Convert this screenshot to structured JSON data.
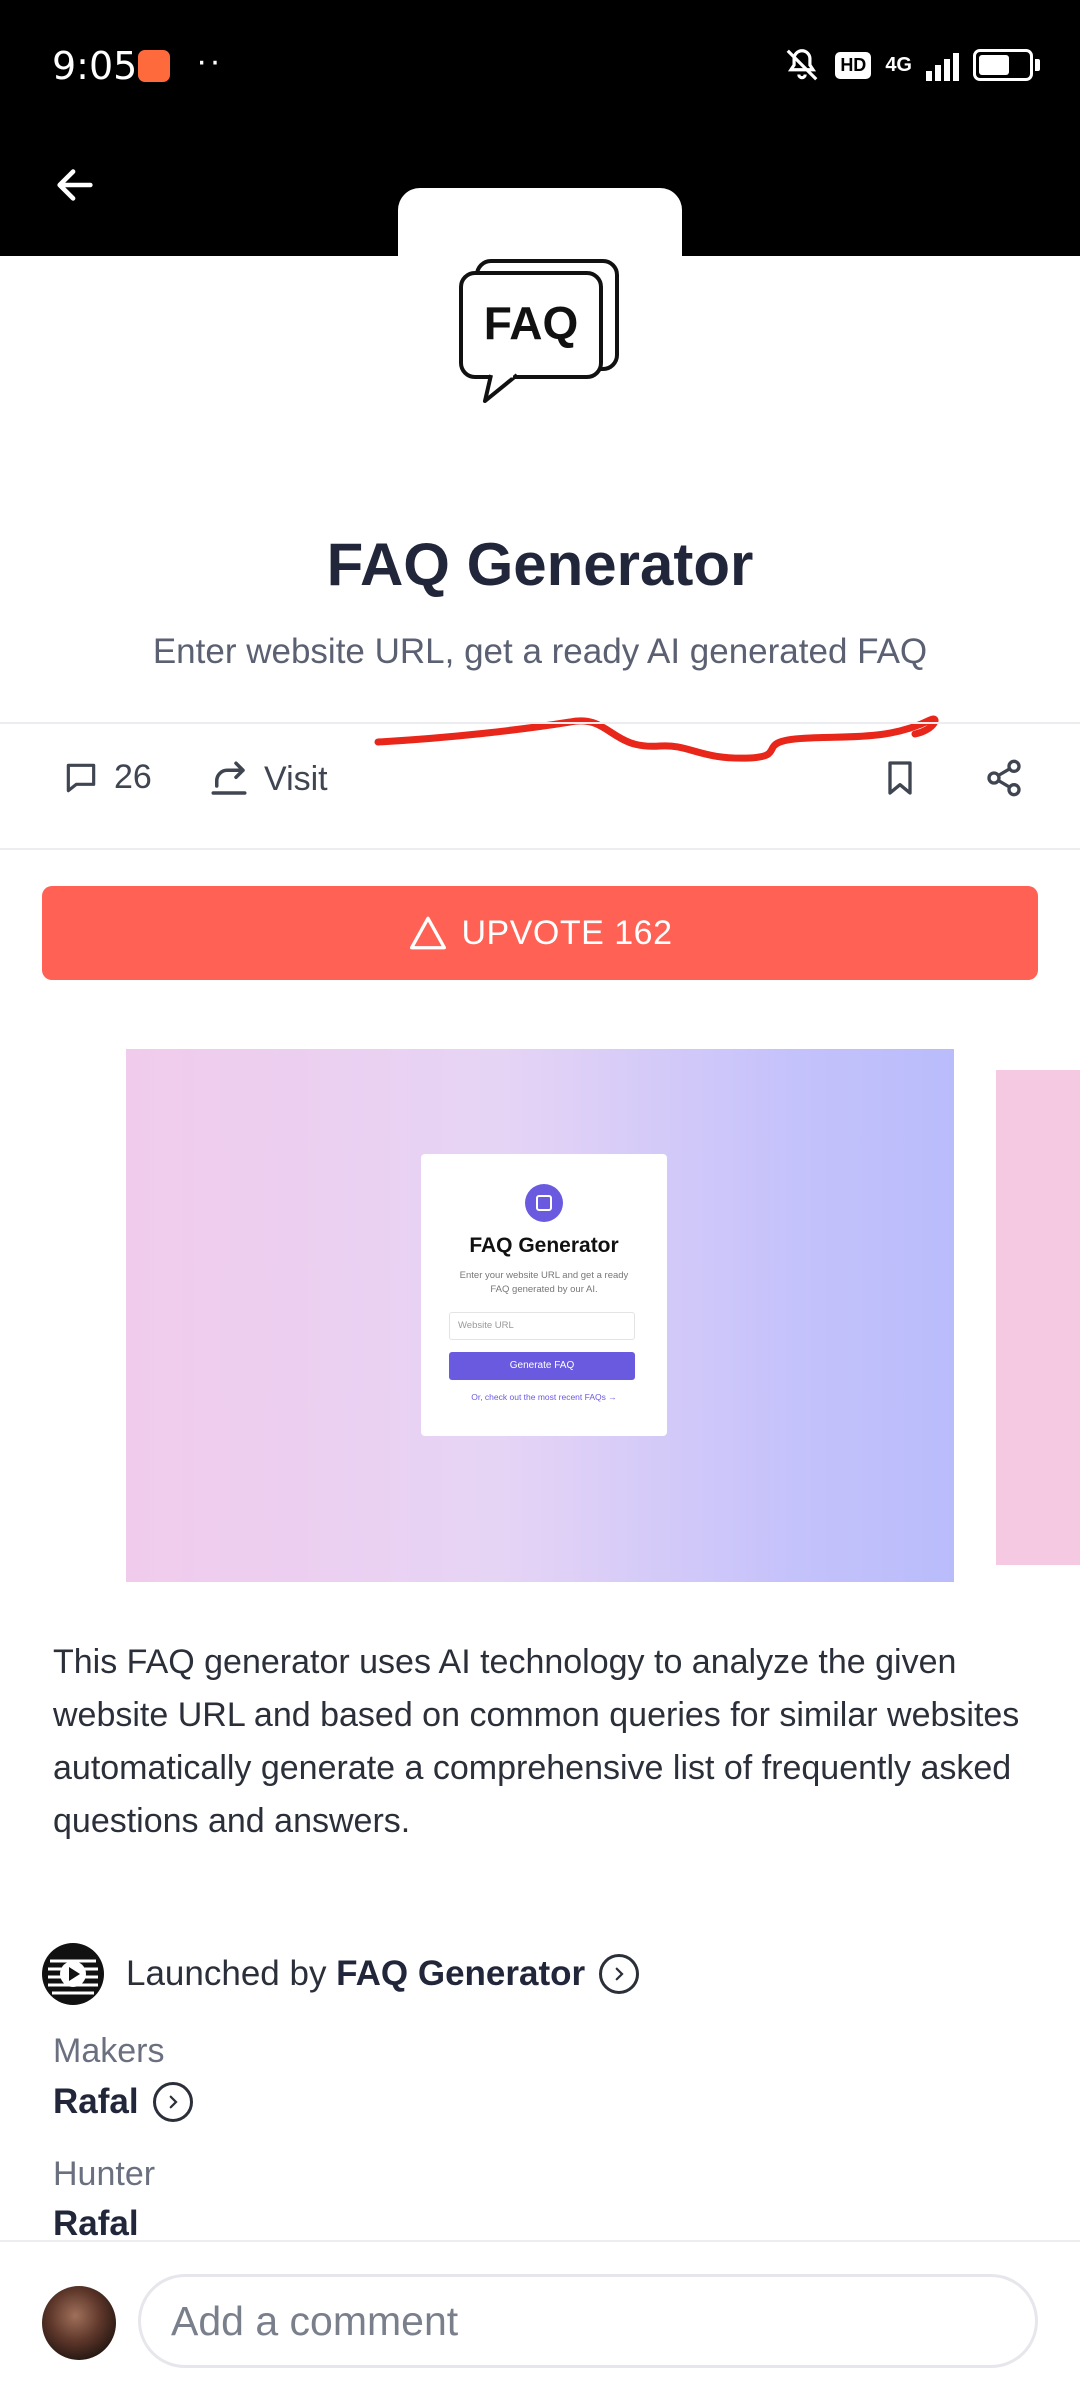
{
  "status_bar": {
    "time": "9:05",
    "overflow": "··",
    "hd_badge": "HD",
    "network": "4G"
  },
  "product": {
    "name": "FAQ Generator",
    "logo_text": "FAQ",
    "tagline": "Enter website URL, get a ready AI generated FAQ",
    "comment_count": "26",
    "visit_label": "Visit",
    "upvote_label": "UPVOTE 162",
    "description": "This FAQ generator uses AI technology to analyze the given website URL and based on common queries for similar websites automatically generate a comprehensive list of frequently asked questions and answers."
  },
  "gallery": {
    "card_title": "FAQ Generator",
    "card_desc": "Enter your website URL and get a ready FAQ generated by our AI.",
    "card_input_placeholder": "Website URL",
    "card_button": "Generate FAQ",
    "card_link": "Or, check out the most recent FAQs →"
  },
  "launch": {
    "prefix": "Launched by ",
    "company": "FAQ Generator"
  },
  "makers": {
    "label": "Makers",
    "name": "Rafal"
  },
  "hunter": {
    "label": "Hunter",
    "name": "Rafal"
  },
  "comment_box": {
    "placeholder": "Add a comment"
  },
  "colors": {
    "upvote": "#ff6154",
    "annotation": "#e8261a",
    "accent": "#6a5ae0"
  }
}
